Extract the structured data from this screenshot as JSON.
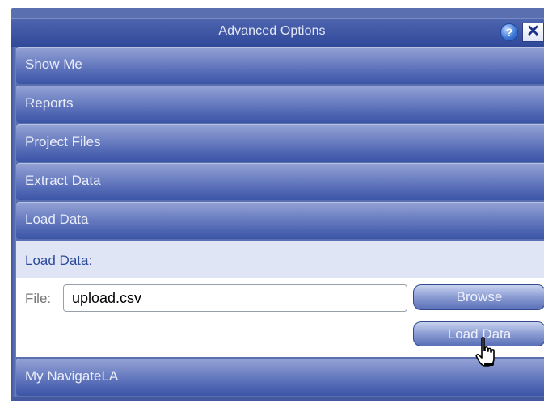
{
  "dialog": {
    "title": "Advanced Options",
    "help_glyph": "?",
    "close_glyph": "✕"
  },
  "sections": [
    {
      "label": "Show Me"
    },
    {
      "label": "Reports"
    },
    {
      "label": "Project Files"
    },
    {
      "label": "Extract Data"
    },
    {
      "label": "Load Data"
    },
    {
      "label": "My NavigateLA"
    }
  ],
  "load_panel": {
    "heading": "Load Data:",
    "file_label": "File:",
    "file_value": "upload.csv",
    "browse_label": "Browse",
    "load_label": "Load Data"
  },
  "colors": {
    "title_bar": "#2f4898",
    "section_bar": "#5a70b8",
    "panel_head": "#dfe5f5",
    "heading_text": "#2d4a9a"
  },
  "icons": {
    "help": "help-icon",
    "close": "close-icon",
    "cursor": "hand-pointer-icon"
  }
}
